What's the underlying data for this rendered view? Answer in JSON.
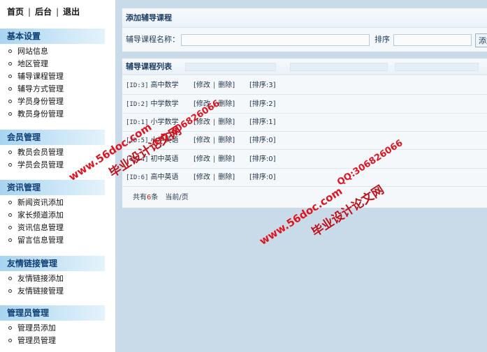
{
  "top_nav": {
    "home": "首页",
    "backend": "后台",
    "logout": "退出",
    "separator": "|"
  },
  "sidebar": {
    "groups": [
      {
        "title": "基本设置",
        "items": [
          "网站信息",
          "地区管理",
          "辅导课程管理",
          "辅导方式管理",
          "学员身份管理",
          "教员身份管理"
        ]
      },
      {
        "title": "会员管理",
        "items": [
          "教员会员管理",
          "学员会员管理"
        ]
      },
      {
        "title": "资讯管理",
        "items": [
          "新闻资讯添加",
          "家长频道添加",
          "资讯信息管理",
          "留言信息管理"
        ]
      },
      {
        "title": "友情链接管理",
        "items": [
          "友情链接添加",
          "友情链接管理"
        ]
      },
      {
        "title": "管理员管理",
        "items": [
          "管理员添加",
          "管理员管理"
        ]
      }
    ]
  },
  "add_form": {
    "title": "添加辅导课程",
    "name_label": "辅导课程名称：",
    "name_value": "",
    "sort_label": "排序",
    "sort_value": "",
    "submit_label": "添加"
  },
  "course_list": {
    "title": "辅导课程列表",
    "edit_label": "[修改",
    "delete_label": "删除]",
    "rows": [
      {
        "id": "[ID:3]",
        "name": "高中数学",
        "sort": "[排序:3]"
      },
      {
        "id": "[ID:2]",
        "name": "中学数学",
        "sort": "[排序:2]"
      },
      {
        "id": "[ID:1]",
        "name": "小学数学",
        "sort": "[排序:1]"
      },
      {
        "id": "[ID:5]",
        "name": "小学英语",
        "sort": "[排序:0]"
      },
      {
        "id": "[ID:4]",
        "name": "初中英语",
        "sort": "[排序:0]"
      },
      {
        "id": "[ID:6]",
        "name": "高中英语",
        "sort": "[排序:0]"
      }
    ],
    "pager": {
      "prefix": "共有",
      "count": "6",
      "suffix": "条",
      "current": "当前/页"
    }
  },
  "watermarks": {
    "site_url": "www.56doc.com",
    "qq": "QQ:306826066",
    "brand": "毕业设计论文网"
  },
  "colors": {
    "sidebar_header_bg": "#a9d4ef",
    "main_bg": "#c9dbe9",
    "watermark": "#e0141e",
    "count_highlight": "#d02020"
  }
}
